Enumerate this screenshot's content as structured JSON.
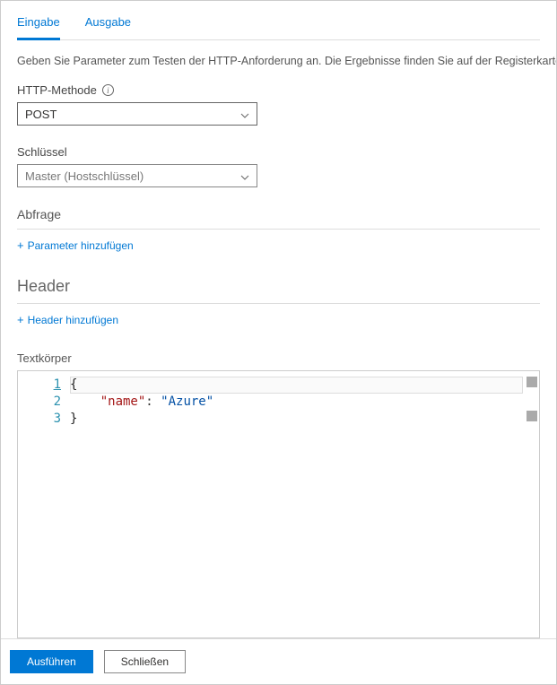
{
  "tabs": {
    "input": "Eingabe",
    "output": "Ausgabe"
  },
  "description": "Geben Sie Parameter zum Testen der HTTP-Anforderung an. Die Ergebnisse finden Sie auf der Registerkarte",
  "httpMethod": {
    "label": "HTTP-Methode",
    "value": "POST"
  },
  "key": {
    "label": "Schlüssel",
    "value": "Master (Hostschlüssel)"
  },
  "query": {
    "header": "Abfrage",
    "addLabel": "Parameter hinzufügen"
  },
  "headers": {
    "header": "Header",
    "addLabel": "Header hinzufügen"
  },
  "body": {
    "label": "Textkörper",
    "lines": [
      {
        "n": 1,
        "raw": "{"
      },
      {
        "n": 2,
        "raw": "    \"name\": \"Azure\""
      },
      {
        "n": 3,
        "raw": "}"
      }
    ]
  },
  "footer": {
    "run": "Ausführen",
    "close": "Schließen"
  }
}
